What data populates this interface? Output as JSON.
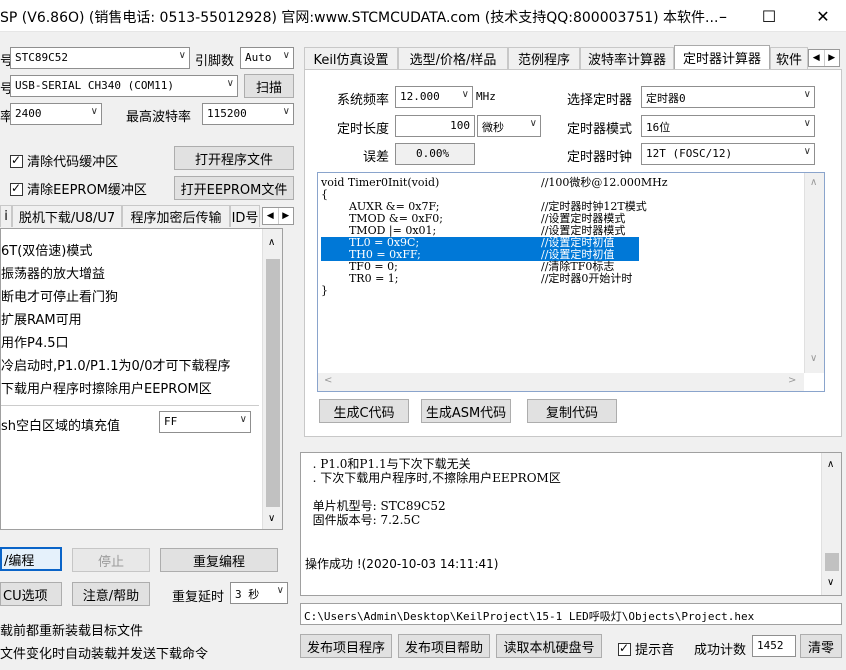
{
  "window": {
    "title": "SP (V6.86O) (销售电话: 0513-55012928) 官网:www.STCMCUDATA.com (技术支持QQ:800003751) 本软件...",
    "minimize_glyph": "–",
    "maximize_glyph": "☐",
    "close_glyph": "✕"
  },
  "left": {
    "mcu_label": "号",
    "mcu_value": "STC89C52",
    "pin_label": "引脚数",
    "pin_value": "Auto",
    "port_label": "号",
    "port_value": "USB-SERIAL CH340 (COM11)",
    "scan_button": "扫描",
    "baud_label": "率",
    "baud_value": "2400",
    "max_baud_label": "最高波特率",
    "max_baud_value": "115200",
    "clear_code_label": "清除代码缓冲区",
    "clear_code_checked": true,
    "open_program_button": "打开程序文件",
    "clear_eeprom_label": "清除EEPROM缓冲区",
    "clear_eeprom_checked": true,
    "open_eeprom_button": "打开EEPROM文件",
    "tabs": [
      "脱机下载/U8/U7",
      "程序加密后传输",
      "ID号"
    ],
    "tab_first_fragment": "i",
    "options": [
      "6T(双倍速)模式",
      "振荡器的放大增益",
      "断电才可停止看门狗",
      "扩展RAM可用",
      "用作P4.5口",
      "冷启动时,P1.0/P1.1为0/0才可下载程序",
      "下载用户程序时擦除用户EEPROM区"
    ],
    "fill_label": "sh空白区域的填充值",
    "fill_value": "FF",
    "download_button": "/编程",
    "stop_button": "停止",
    "reprogram_button": "重复编程",
    "mcu_options_button": "CU选项",
    "help_button": "注意/帮助",
    "repeat_delay_label": "重复延时",
    "repeat_delay_value": "3 秒",
    "reload_label": "载前都重新装载目标文件",
    "auto_send_label": "文件变化时自动装载并发送下载命令"
  },
  "right": {
    "tabs": [
      "Keil仿真设置",
      "选型/价格/样品",
      "范例程序",
      "波特率计算器",
      "定时器计算器",
      "软件"
    ],
    "active_tab": 4,
    "sys_freq_label": "系统频率",
    "sys_freq_value": "12.000",
    "sys_freq_unit": "MHz",
    "timer_select_label": "选择定时器",
    "timer_select_value": "定时器0",
    "timer_len_label": "定时长度",
    "timer_len_value": "100",
    "timer_len_unit": "微秒",
    "timer_mode_label": "定时器模式",
    "timer_mode_value": "16位",
    "error_label": "误差",
    "error_value": "0.00%",
    "timer_clock_label": "定时器时钟",
    "timer_clock_value": "12T (FOSC/12)",
    "code_lines": [
      {
        "code": "void Timer0Init(void)",
        "comment": "//100微秒@12.000MHz",
        "sel": false
      },
      {
        "code": "{",
        "comment": "",
        "sel": false
      },
      {
        "code": "        AUXR &= 0x7F;",
        "comment": "//定时器时钟12T模式",
        "sel": false
      },
      {
        "code": "        TMOD &= 0xF0;",
        "comment": "//设置定时器模式",
        "sel": false
      },
      {
        "code": "        TMOD |= 0x01;",
        "comment": "//设置定时器模式",
        "sel": false
      },
      {
        "code": "        TL0 = 0x9C;",
        "comment": "//设置定时初值",
        "sel": true
      },
      {
        "code": "        TH0 = 0xFF;",
        "comment": "//设置定时初值",
        "sel": true
      },
      {
        "code": "        TF0 = 0;",
        "comment": "//清除TF0标志",
        "sel": false
      },
      {
        "code": "        TR0 = 1;",
        "comment": "//定时器0开始计时",
        "sel": false
      },
      {
        "code": "}",
        "comment": "",
        "sel": false
      }
    ],
    "gen_c_button": "生成C代码",
    "gen_asm_button": "生成ASM代码",
    "copy_button": "复制代码",
    "log_lines": [
      "  . P1.0和P1.1与下次下载无关",
      "  . 下次下载用户程序时,不擦除用户EEPROM区",
      "",
      "  单片机型号: STC89C52",
      "  固件版本号: 7.2.5C",
      "",
      "",
      "操作成功 !(2020-10-03 14:11:41)"
    ],
    "file_path": "C:\\Users\\Admin\\Desktop\\KeilProject\\15-1 LED呼吸灯\\Objects\\Project.hex",
    "publish_button": "发布项目程序",
    "publish_help_button": "发布项目帮助",
    "read_disk_button": "读取本机硬盘号",
    "sound_label": "提示音",
    "sound_checked": true,
    "success_count_label": "成功计数",
    "success_count_value": "1452",
    "clear_button": "清零"
  }
}
